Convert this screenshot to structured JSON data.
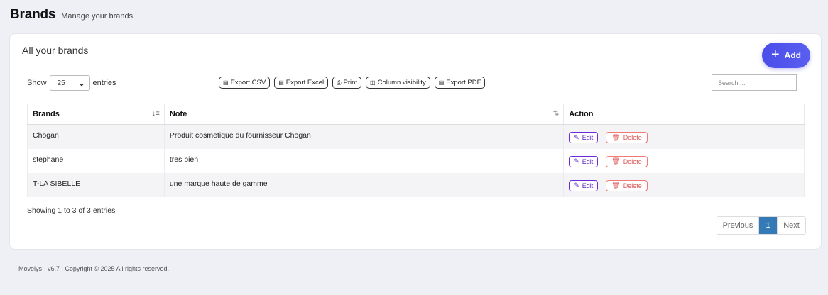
{
  "header": {
    "title": "Brands",
    "subtitle": "Manage your brands"
  },
  "card": {
    "title": "All your brands",
    "add_label": "Add"
  },
  "length": {
    "show_label": "Show",
    "value": "25",
    "entries_label": "entries"
  },
  "exports": [
    {
      "label": "Export CSV",
      "icon": "file-csv-icon"
    },
    {
      "label": "Export Excel",
      "icon": "file-excel-icon"
    },
    {
      "label": "Print",
      "icon": "print-icon"
    },
    {
      "label": "Column visibility",
      "icon": "columns-icon"
    },
    {
      "label": "Export PDF",
      "icon": "file-pdf-icon"
    }
  ],
  "search": {
    "placeholder": "Search ..."
  },
  "table": {
    "headers": [
      "Brands",
      "Note",
      "Action"
    ],
    "rows": [
      {
        "brand": "Chogan",
        "note": "Produit cosmetique du fournisseur Chogan"
      },
      {
        "brand": "stephane",
        "note": "tres bien"
      },
      {
        "brand": "T-LA SIBELLE",
        "note": "une marque haute de gamme"
      }
    ],
    "edit_label": "Edit",
    "delete_label": "Delete"
  },
  "info": "Showing 1 to 3 of 3 entries",
  "pagination": {
    "previous": "Previous",
    "current": "1",
    "next": "Next"
  },
  "footer": "Movelys - v6.7 | Copyright © 2025 All rights reserved.",
  "colors": {
    "accent": "#4a4de8",
    "edit": "#5b21c4",
    "delete": "#e05555",
    "page_active": "#337ab7"
  }
}
